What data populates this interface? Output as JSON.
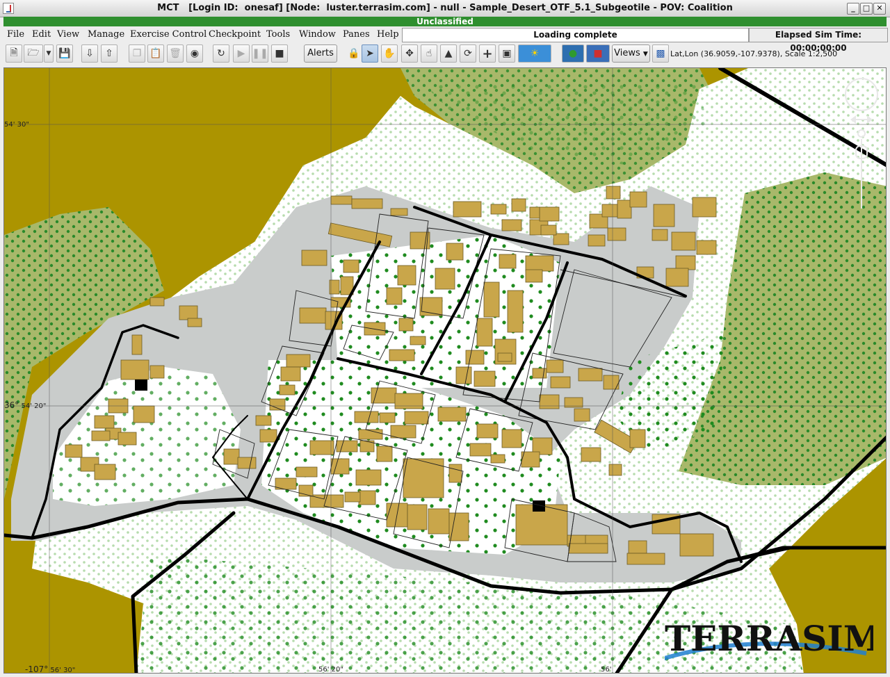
{
  "window": {
    "title": "MCT   [Login ID:  onesaf] [Node:  luster.terrasim.com] - null - Sample_Desert_OTF_5.1_Subgeotile - POV: Coalition",
    "controls": [
      "_",
      "□",
      "✕"
    ]
  },
  "classification": "Unclassified",
  "menu": {
    "items": [
      "File",
      "Edit",
      "View",
      "Manage",
      "Exercise Control",
      "Checkpoint",
      "Tools",
      "Window",
      "Panes",
      "Help"
    ]
  },
  "status": {
    "message": "Loading complete",
    "elapsed": "Elapsed Sim Time: 00:00:00:00"
  },
  "toolbar": {
    "alerts_label": "Alerts",
    "views_label": "Views",
    "coords": "Lat,Lon (36.9059,-107.9378), Scale 1:2,500",
    "icons": [
      "new-icon",
      "open-icon",
      "dropdown-arrow-icon",
      "save-icon",
      "import-icon",
      "export-icon",
      "copy-icon",
      "paste-icon",
      "delete-icon",
      "binoculars-icon",
      "refresh-icon",
      "play-icon",
      "pause-icon",
      "stop-icon",
      "lock-icon",
      "pointer-icon",
      "hand-pan-icon",
      "zoom-extent-icon",
      "touch-icon",
      "terrain-icon",
      "rotate-icon",
      "crosshair-icon",
      "tag-icon",
      "sun-icon",
      "globe-icon",
      "map-layers-icon",
      "cube-icon"
    ]
  },
  "map": {
    "grid_labels": {
      "lat_top": "54' 30\"",
      "lat_mid_deg": "36°",
      "lat_mid_min": "54' 20\"",
      "lon_left_deg": "-107°",
      "lon_left_min": "56' 30\"",
      "lon_mid": "56' 20\"",
      "lon_right": "56'"
    },
    "colors": {
      "desert": "#ac9400",
      "vegetation": "#a8b86a",
      "urban_ground": "#ffffff",
      "pavement": "#c9cccb",
      "building": "#c9a64a",
      "road": "#000000",
      "tree": "#1f8b1f"
    },
    "logo": "TERRASIM"
  }
}
